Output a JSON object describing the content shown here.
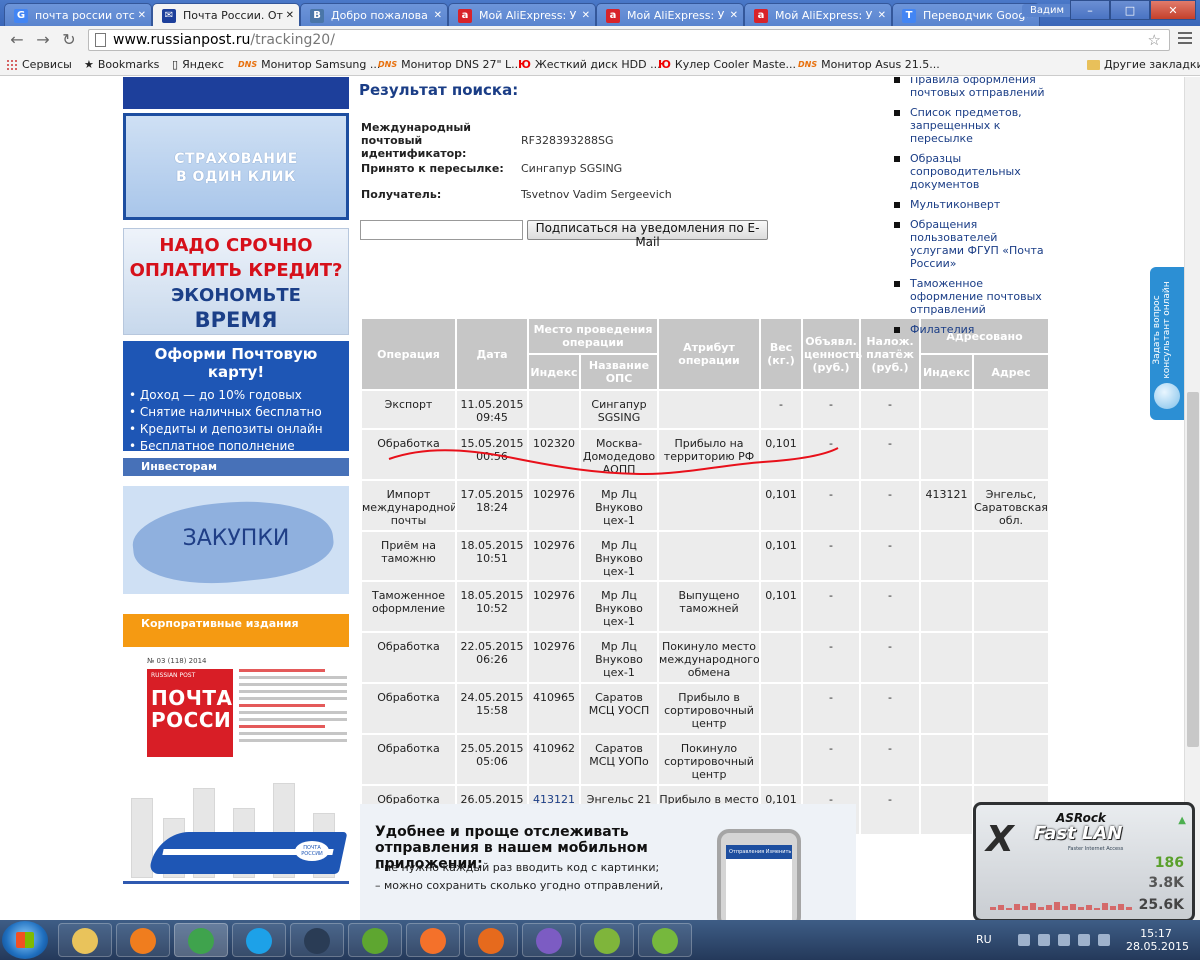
{
  "browser": {
    "tabs": [
      {
        "label": "почта россии отс",
        "favicon": "G",
        "color": "#4285f4"
      },
      {
        "label": "Почта России. От",
        "favicon": "✉",
        "color": "#1d3f9b",
        "active": true
      },
      {
        "label": "Добро пожалова",
        "favicon": "В",
        "color": "#4a76a8"
      },
      {
        "label": "Мой AliExpress: У",
        "favicon": "a",
        "color": "#d8232a"
      },
      {
        "label": "Мой AliExpress: У",
        "favicon": "a",
        "color": "#d8232a"
      },
      {
        "label": "Мой AliExpress: У",
        "favicon": "a",
        "color": "#d8232a"
      },
      {
        "label": "Переводчик Goog",
        "favicon": "T",
        "color": "#4285f4"
      }
    ],
    "user": "Вадим",
    "url_host": "www.russianpost.ru",
    "url_path": "/tracking20/",
    "bookmarks": [
      {
        "label": "Сервисы",
        "icon": "apps-icon"
      },
      {
        "label": "Bookmarks",
        "icon": "star-icon"
      },
      {
        "label": "Яндекс",
        "icon": "page-icon"
      },
      {
        "label": "Монитор Samsung ...",
        "icon": "dns-icon"
      },
      {
        "label": "Монитор DNS 27\" L...",
        "icon": "dns-icon"
      },
      {
        "label": "Жесткий диск HDD ...",
        "icon": "ju-icon"
      },
      {
        "label": "Кулер Cooler Maste...",
        "icon": "ju-icon"
      },
      {
        "label": "Монитор Asus 21.5...",
        "icon": "dns-icon"
      }
    ],
    "other_bookmarks": "Другие закладки"
  },
  "left": {
    "insurance": [
      "СТРАХОВАНИЕ",
      "В ОДИН КЛИК"
    ],
    "credit": [
      "НАДО СРОЧНО",
      "ОПЛАТИТЬ КРЕДИТ?",
      "ЭКОНОМЬТЕ",
      "ВРЕМЯ"
    ],
    "card_title": "Оформи Почтовую карту!",
    "card_items": [
      "• Доход — до 10% годовых",
      "• Снятие наличных бесплатно",
      "• Кредиты и депозиты онлайн",
      "• Бесплатное пополнение"
    ],
    "investors": "Инвесторам",
    "zakupki": "ЗАКУПКИ",
    "corporate": "Корпоративные издания",
    "mag_issue": "№ 03 (118) 2014",
    "mag_brand": "RUSSIAN POST",
    "mag_logo": "ПОЧТА РОССИИ",
    "train_badge": "ПОЧТА РОССИИ"
  },
  "result": {
    "title": "Результат поиска:",
    "id_label": "Международный почтовый идентификатор:",
    "id_value": "RF328393288SG",
    "accepted_label": "Принято к пересылке:",
    "accepted_value": "Сингапур SGSING",
    "recipient_label": "Получатель:",
    "recipient_value": "Tsvetnov Vadim Sergeevich",
    "subscribe_label": "Подписаться на уведомления по E-Mail",
    "email_value": ""
  },
  "table": {
    "headers": {
      "operation": "Операция",
      "date": "Дата",
      "place": "Место проведения операции",
      "index": "Индекс",
      "ops": "Название ОПС",
      "attr": "Атрибут операции",
      "weight": "Вес (кг.)",
      "declared": "Объявл. ценность (руб.)",
      "cod": "Налож. платёж (руб.)",
      "addressed": "Адресовано",
      "addr_index": "Индекс",
      "addr": "Адрес"
    },
    "rows": [
      {
        "op": "Экспорт",
        "date": "11.05.2015 09:45",
        "idx": "",
        "ops": "Сингапур SGSING",
        "attr": "",
        "w": "-",
        "dv": "-",
        "cod": "-",
        "aidx": "",
        "addr": ""
      },
      {
        "op": "Обработка",
        "date": "15.05.2015 00:56",
        "idx": "102320",
        "ops": "Москва-Домодедово АОПП",
        "attr": "Прибыло на территорию РФ",
        "w": "0,101",
        "dv": "-",
        "cod": "-",
        "aidx": "",
        "addr": ""
      },
      {
        "op": "Импорт международной почты",
        "date": "17.05.2015 18:24",
        "idx": "102976",
        "ops": "Мр Лц Внуково цех-1",
        "attr": "",
        "w": "0,101",
        "dv": "-",
        "cod": "-",
        "aidx": "413121",
        "addr": "Энгельс, Саратовская обл."
      },
      {
        "op": "Приём на таможню",
        "date": "18.05.2015 10:51",
        "idx": "102976",
        "ops": "Мр Лц Внуково цех-1",
        "attr": "",
        "w": "0,101",
        "dv": "-",
        "cod": "-",
        "aidx": "",
        "addr": ""
      },
      {
        "op": "Таможенное оформление",
        "date": "18.05.2015 10:52",
        "idx": "102976",
        "ops": "Мр Лц Внуково цех-1",
        "attr": "Выпущено таможней",
        "w": "0,101",
        "dv": "-",
        "cod": "-",
        "aidx": "",
        "addr": ""
      },
      {
        "op": "Обработка",
        "date": "22.05.2015 06:26",
        "idx": "102976",
        "ops": "Мр Лц Внуково цех-1",
        "attr": "Покинуло место международного обмена",
        "w": "",
        "dv": "-",
        "cod": "-",
        "aidx": "",
        "addr": ""
      },
      {
        "op": "Обработка",
        "date": "24.05.2015 15:58",
        "idx": "410965",
        "ops": "Саратов МСЦ УОСП",
        "attr": "Прибыло в сортировочный центр",
        "w": "",
        "dv": "-",
        "cod": "-",
        "aidx": "",
        "addr": ""
      },
      {
        "op": "Обработка",
        "date": "25.05.2015 05:06",
        "idx": "410962",
        "ops": "Саратов МСЦ УОПо",
        "attr": "Покинуло сортировочный центр",
        "w": "",
        "dv": "-",
        "cod": "-",
        "aidx": "",
        "addr": ""
      },
      {
        "op": "Обработка",
        "date": "26.05.2015 14:35",
        "idx": "413121",
        "idx_link": true,
        "ops": "Энгельс 21",
        "attr": "Прибыло в место вручения",
        "w": "0,101",
        "dv": "-",
        "cod": "-",
        "aidx": "",
        "addr": ""
      }
    ]
  },
  "right_links": [
    "Правила оформления почтовых отправлений",
    "Список предметов, запрещенных к пересылке",
    "Образцы сопроводительных документов",
    "Мультиконверт",
    "Обращения пользователей услугами ФГУП «Почта России»",
    "Таможенное оформление почтовых отправлений",
    "Филателия"
  ],
  "consult": "Задать вопрос консультант онлайн",
  "promo": {
    "title": "Удобнее и проще отслеживать отправления в нашем мобильном приложении:",
    "bullets": [
      "– не нужно каждый раз вводить код с картинки;",
      "– можно сохранить сколько угодно отправлений,"
    ],
    "phone_tabs": "Отправления   Изменить"
  },
  "widget": {
    "brand": "ASRock",
    "product": "Fast LAN",
    "tagline": "Faster Internet Access",
    "values": [
      "186",
      "3.8K",
      "25.6K"
    ]
  },
  "taskbar": {
    "lang": "RU",
    "time": "15:17",
    "date": "28.05.2015"
  },
  "colors": {
    "accent": "#1a3d86",
    "header_gray": "#c6c6c6",
    "row_gray": "#ececec",
    "annotation_red": "#e8101a"
  }
}
